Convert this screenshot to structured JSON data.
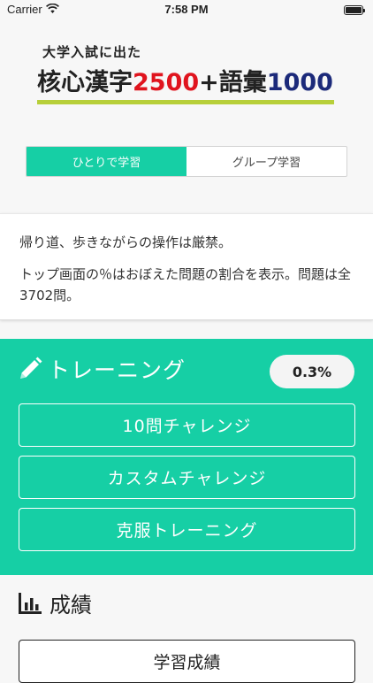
{
  "status_bar": {
    "carrier": "Carrier",
    "time": "7:58 PM",
    "wifi_icon": "wifi-icon",
    "battery_icon": "battery-icon"
  },
  "logo": {
    "subtitle": "大学入試に出た",
    "part1": "核心漢字",
    "num1": "2500",
    "part2": "+語彙",
    "num2": "1000",
    "colors": {
      "red": "#e0141e",
      "blue": "#1c2a7a",
      "underline": "#b7cf3a"
    }
  },
  "mode_tabs": [
    {
      "label": "ひとりで学習",
      "active": true
    },
    {
      "label": "グループ学習",
      "active": false
    }
  ],
  "info": {
    "line1": "帰り道、歩きながらの操作は厳禁。",
    "line2": "トップ画面の％はおぼえた問題の割合を表示。問題は全3702問。"
  },
  "training": {
    "icon": "pencil-icon",
    "title": "トレーニング",
    "progress": "0.3%",
    "buttons": [
      "10問チャレンジ",
      "カスタムチャレンジ",
      "克服トレーニング"
    ],
    "accent": "#16cfa5"
  },
  "results": {
    "icon": "bar-chart-icon",
    "title": "成績",
    "button": "学習成績"
  }
}
